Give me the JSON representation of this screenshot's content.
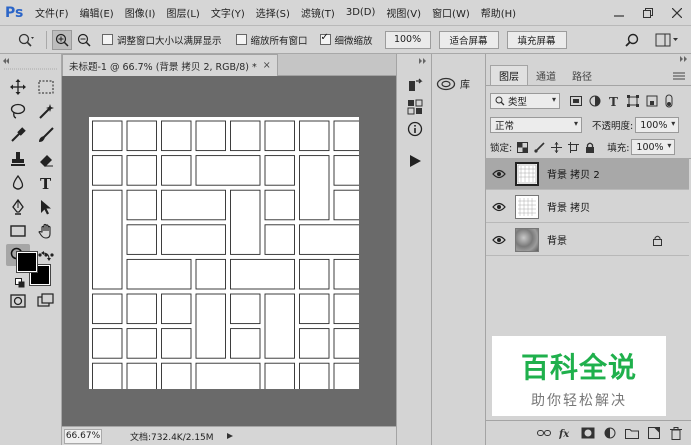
{
  "app": {
    "logo": "Ps"
  },
  "menu": [
    "文件(F)",
    "编辑(E)",
    "图像(I)",
    "图层(L)",
    "文字(Y)",
    "选择(S)",
    "滤镜(T)",
    "3D(D)",
    "视图(V)",
    "窗口(W)",
    "帮助(H)"
  ],
  "options": {
    "resize_windows": "调整窗口大小以满屏显示",
    "zoom_all": "缩放所有窗口",
    "scrubby_zoom": "细微缩放",
    "scrubby_checked": true,
    "zoom_100": "100%",
    "fit_screen": "适合屏幕",
    "fill_screen": "填充屏幕"
  },
  "document": {
    "tab_title": "未标题-1 @ 66.7% (背景 拷贝 2, RGB/8) *",
    "zoom": "66.67%",
    "doc_info": "文档:732.4K/2.15M"
  },
  "library": {
    "label": "库"
  },
  "layers_panel": {
    "tabs": [
      "图层",
      "通道",
      "路径"
    ],
    "filter_kind": "类型",
    "blend_mode": "正常",
    "opacity_label": "不透明度:",
    "opacity": "100%",
    "lock_label": "锁定:",
    "fill_label": "填充:",
    "fill": "100%",
    "layers": [
      {
        "name": "背景 拷贝 2",
        "selected": true
      },
      {
        "name": "背景 拷贝",
        "selected": false
      },
      {
        "name": "背景",
        "selected": false,
        "locked": true
      }
    ]
  },
  "watermark": {
    "title": "百科全说",
    "subtitle": "助你轻松解决"
  },
  "colors": {
    "accent": "#2b65c8",
    "watermark_green": "#1fb04c",
    "canvas_bg": "#6a6a6a"
  }
}
